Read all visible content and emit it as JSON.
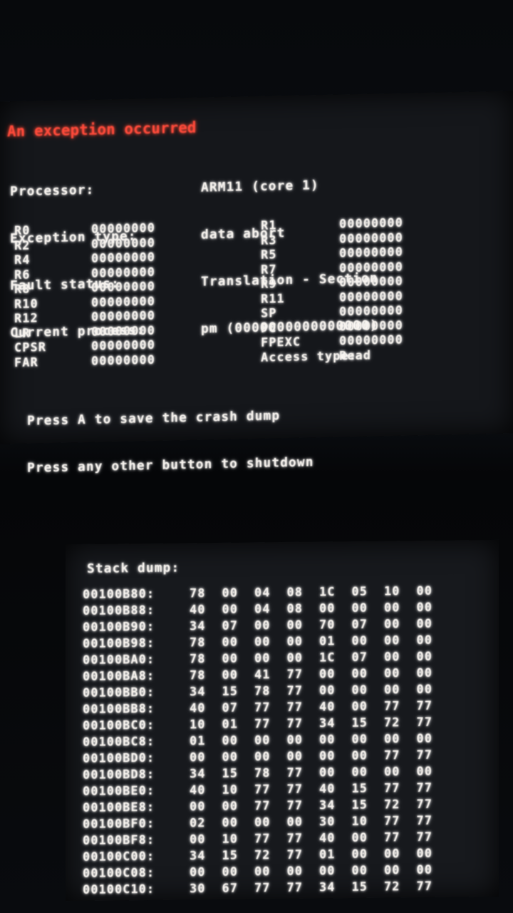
{
  "crash_screen": {
    "title": "An exception occurred",
    "info": [
      {
        "label": "Processor:",
        "value": "ARM11 (core 1)"
      },
      {
        "label": "Exception type:",
        "value": "data abort"
      },
      {
        "label": "Fault status:",
        "value": "Translation - Section"
      },
      {
        "label": "Current process:",
        "value": "pm (0000000000000000)"
      }
    ],
    "registers_left": [
      {
        "name": "R0",
        "value": "00000000"
      },
      {
        "name": "R2",
        "value": "00000000"
      },
      {
        "name": "R4",
        "value": "00000000"
      },
      {
        "name": "R6",
        "value": "00000000"
      },
      {
        "name": "R8",
        "value": "00000000"
      },
      {
        "name": "R10",
        "value": "00000000"
      },
      {
        "name": "R12",
        "value": "00000000"
      },
      {
        "name": "LR",
        "value": "00000000"
      },
      {
        "name": "CPSR",
        "value": "00000000"
      },
      {
        "name": "FAR",
        "value": "00000000"
      }
    ],
    "registers_right": [
      {
        "name": "R1",
        "value": "00000000"
      },
      {
        "name": "R3",
        "value": "00000000"
      },
      {
        "name": "R5",
        "value": "00000000"
      },
      {
        "name": "R7",
        "value": "00000000"
      },
      {
        "name": "R9",
        "value": "00000000"
      },
      {
        "name": "R11",
        "value": "00000000"
      },
      {
        "name": "SP",
        "value": "00000000"
      },
      {
        "name": "PC",
        "value": "00000000"
      },
      {
        "name": "FPEXC",
        "value": "00000000"
      },
      {
        "name": "Access type:",
        "value": "Read"
      }
    ],
    "hints": [
      "Press A to save the crash dump",
      "Press any other button to shutdown"
    ]
  },
  "stack_screen": {
    "title": "Stack dump:",
    "rows": [
      {
        "addr": "00100B80:",
        "bytes": [
          "78",
          "00",
          "04",
          "08",
          "1C",
          "05",
          "10",
          "00"
        ]
      },
      {
        "addr": "00100B88:",
        "bytes": [
          "40",
          "00",
          "04",
          "08",
          "00",
          "00",
          "00",
          "00"
        ]
      },
      {
        "addr": "00100B90:",
        "bytes": [
          "34",
          "07",
          "00",
          "00",
          "70",
          "07",
          "00",
          "00"
        ]
      },
      {
        "addr": "00100B98:",
        "bytes": [
          "78",
          "00",
          "00",
          "00",
          "01",
          "00",
          "00",
          "00"
        ]
      },
      {
        "addr": "00100BA0:",
        "bytes": [
          "78",
          "00",
          "00",
          "00",
          "1C",
          "07",
          "00",
          "00"
        ]
      },
      {
        "addr": "00100BA8:",
        "bytes": [
          "78",
          "00",
          "41",
          "77",
          "00",
          "00",
          "00",
          "00"
        ]
      },
      {
        "addr": "00100BB0:",
        "bytes": [
          "34",
          "15",
          "78",
          "77",
          "00",
          "00",
          "00",
          "00"
        ]
      },
      {
        "addr": "00100BB8:",
        "bytes": [
          "40",
          "07",
          "77",
          "77",
          "40",
          "00",
          "77",
          "77"
        ]
      },
      {
        "addr": "00100BC0:",
        "bytes": [
          "10",
          "01",
          "77",
          "77",
          "34",
          "15",
          "72",
          "77"
        ]
      },
      {
        "addr": "00100BC8:",
        "bytes": [
          "01",
          "00",
          "00",
          "00",
          "00",
          "00",
          "00",
          "00"
        ]
      },
      {
        "addr": "00100BD0:",
        "bytes": [
          "00",
          "00",
          "00",
          "00",
          "00",
          "00",
          "77",
          "77"
        ]
      },
      {
        "addr": "00100BD8:",
        "bytes": [
          "34",
          "15",
          "78",
          "77",
          "00",
          "00",
          "00",
          "00"
        ]
      },
      {
        "addr": "00100BE0:",
        "bytes": [
          "40",
          "10",
          "77",
          "77",
          "40",
          "15",
          "77",
          "77"
        ]
      },
      {
        "addr": "00100BE8:",
        "bytes": [
          "00",
          "00",
          "77",
          "77",
          "34",
          "15",
          "72",
          "77"
        ]
      },
      {
        "addr": "00100BF0:",
        "bytes": [
          "02",
          "00",
          "00",
          "00",
          "30",
          "10",
          "77",
          "77"
        ]
      },
      {
        "addr": "00100BF8:",
        "bytes": [
          "00",
          "10",
          "77",
          "77",
          "40",
          "00",
          "77",
          "77"
        ]
      },
      {
        "addr": "00100C00:",
        "bytes": [
          "34",
          "15",
          "72",
          "77",
          "01",
          "00",
          "00",
          "00"
        ]
      },
      {
        "addr": "00100C08:",
        "bytes": [
          "00",
          "00",
          "00",
          "00",
          "00",
          "00",
          "00",
          "00"
        ]
      },
      {
        "addr": "00100C10:",
        "bytes": [
          "30",
          "67",
          "77",
          "77",
          "34",
          "15",
          "72",
          "77"
        ]
      }
    ]
  }
}
